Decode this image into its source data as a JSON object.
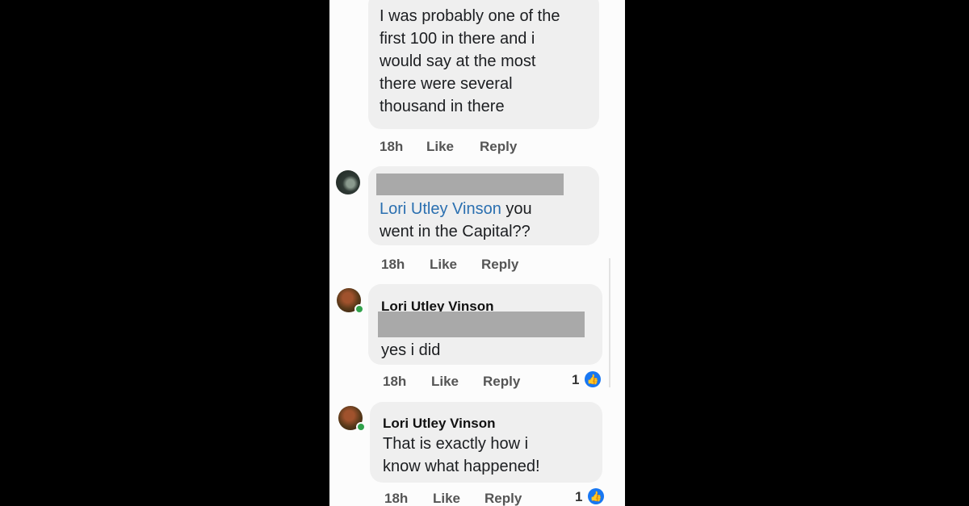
{
  "comments": [
    {
      "text_lines": [
        "I was probably one of the",
        "first 100 in there and i",
        "would say at the most",
        "there were several",
        "thousand in there"
      ],
      "time": "18h",
      "like": "Like",
      "reply": "Reply"
    },
    {
      "mention": "Lori Utley Vinson",
      "text_after_mention": " you",
      "text_line2": "went in the Capital??",
      "time": "18h",
      "like": "Like",
      "reply": "Reply"
    },
    {
      "author": "Lori Utley Vinson",
      "text": "yes i did",
      "time": "18h",
      "like": "Like",
      "reply": "Reply",
      "reaction_count": "1"
    },
    {
      "author": "Lori Utley Vinson",
      "text_lines": [
        "That is exactly how i",
        "know what happened!"
      ],
      "time": "18h",
      "like": "Like",
      "reply": "Reply",
      "reaction_count": "1"
    }
  ],
  "icons": {
    "reaction": "like-thumb-icon",
    "presence": "online-dot-icon"
  },
  "colors": {
    "mention": "#2a6fb0",
    "reaction": "#1877f2",
    "online": "#31a24c",
    "redaction": "#a9a9a9"
  }
}
